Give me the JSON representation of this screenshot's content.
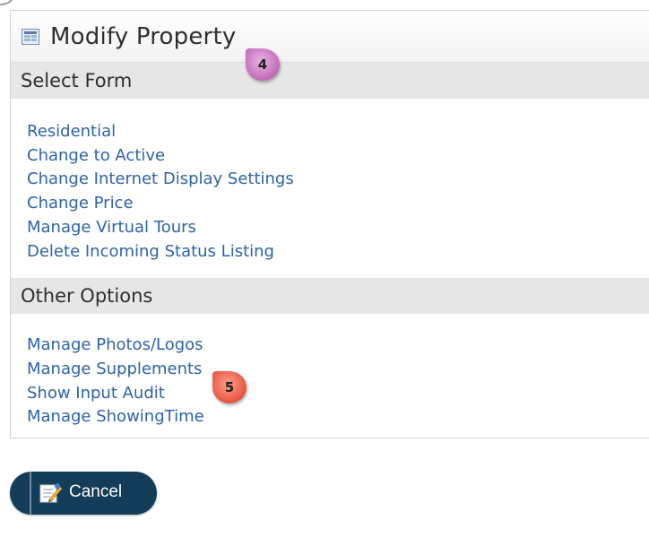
{
  "panel": {
    "title": "Modify Property",
    "title_icon": "form-grid-icon"
  },
  "select_form": {
    "heading": "Select Form",
    "links": [
      "Residential",
      "Change to Active",
      "Change Internet Display Settings",
      "Change Price",
      "Manage Virtual Tours",
      "Delete Incoming Status Listing"
    ]
  },
  "other_options": {
    "heading": "Other Options",
    "links": [
      "Manage Photos/Logos",
      "Manage Supplements",
      "Show Input Audit",
      "Manage ShowingTime"
    ]
  },
  "callouts": {
    "step4": "4",
    "step5": "5"
  },
  "cancel_button": {
    "label": "Cancel",
    "icon": "edit-cancel-icon"
  },
  "colors": {
    "link": "#2e63a8",
    "section_bar": "#e6e6e6",
    "button_bg": "#143d59",
    "callout4": "#c06ab6",
    "callout5": "#e6553d"
  }
}
